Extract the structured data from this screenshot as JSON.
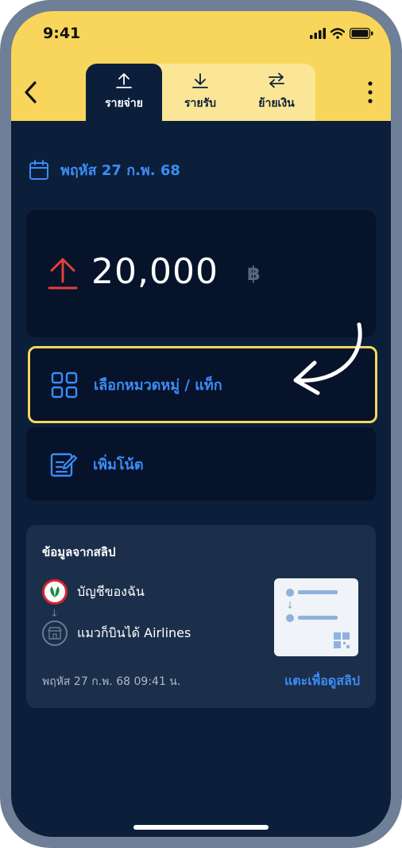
{
  "status_bar": {
    "time": "9:41",
    "icons": [
      "signal-icon",
      "wifi-icon",
      "battery-icon"
    ]
  },
  "header": {
    "back_icon": "chevron-left-icon",
    "more_icon": "more-vertical-icon",
    "tabs": [
      {
        "label": "รายจ่าย",
        "icon": "upload-icon",
        "active": true
      },
      {
        "label": "รายรับ",
        "icon": "download-icon",
        "active": false
      },
      {
        "label": "ย้ายเงิน",
        "icon": "transfer-icon",
        "active": false
      }
    ]
  },
  "date": {
    "icon": "calendar-icon",
    "label": "พฤหัส 27 ก.พ. 68"
  },
  "amount": {
    "icon": "up-arrow-icon",
    "value": "20,000",
    "currency": "฿"
  },
  "actions": {
    "category": {
      "icon": "grid-icon",
      "label": "เลือกหมวดหมู่ / แท็ก"
    },
    "note": {
      "icon": "edit-note-icon",
      "label": "เพิ่มโน้ต"
    }
  },
  "slip": {
    "title": "ข้อมูลจากสลิป",
    "from_label": "บัญชีของฉัน",
    "arrow": "↓",
    "to_label": "แมวก็บินได้ Airlines",
    "datetime": "พฤหัส 27 ก.พ. 68  09:41 น.",
    "view_link": "แตะเพื่อดูสลิป"
  },
  "colors": {
    "accent_yellow": "#f8d65b",
    "background": "#0b1f3a",
    "card": "#06132a",
    "link_blue": "#3d8bf5",
    "expense_red": "#e0403a"
  }
}
